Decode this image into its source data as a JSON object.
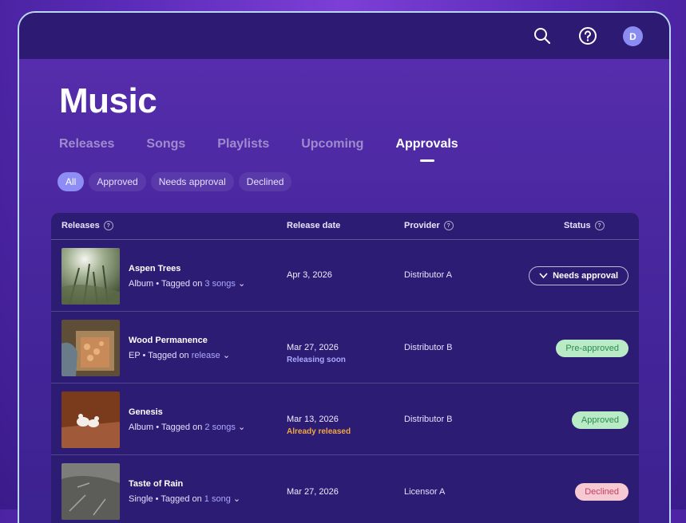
{
  "page": {
    "title": "Music"
  },
  "tabs": [
    "Releases",
    "Songs",
    "Playlists",
    "Upcoming",
    "Approvals"
  ],
  "active_tab": "Approvals",
  "filters": [
    "All",
    "Approved",
    "Needs approval",
    "Declined"
  ],
  "active_filter": "All",
  "user": {
    "avatar_initial": "D"
  },
  "table": {
    "headers": {
      "releases": "Releases",
      "release_date": "Release date",
      "provider": "Provider",
      "status": "Status"
    },
    "rows": [
      {
        "title": "Aspen Trees",
        "type": "Album",
        "tagged_prefix": " • Tagged on ",
        "tagged_link": "3 songs",
        "date": "Apr 3, 2026",
        "note": "",
        "provider": "Distributor A",
        "status": "Needs approval",
        "status_style": "outline"
      },
      {
        "title": "Wood Permanence",
        "type": "EP",
        "tagged_prefix": " • Tagged on ",
        "tagged_link": "release",
        "date": "Mar 27, 2026",
        "note": "Releasing soon",
        "note_color": "#a9a8ff",
        "provider": "Distributor B",
        "status": "Pre-approved",
        "status_style": "green"
      },
      {
        "title": "Genesis",
        "type": "Album",
        "tagged_prefix": " • Tagged on ",
        "tagged_link": "2 songs",
        "date": "Mar 13, 2026",
        "note": "Already released",
        "note_color": "#f0a742",
        "provider": "Distributor B",
        "status": "Approved",
        "status_style": "green"
      },
      {
        "title": "Taste of Rain",
        "type": "Single",
        "tagged_prefix": " • Tagged on ",
        "tagged_link": "1 song",
        "date": "Mar 27, 2026",
        "note": "",
        "provider": "Licensor A",
        "status": "Declined",
        "status_style": "red"
      }
    ]
  },
  "colors": {
    "accent": "#8e8cf5",
    "topbar": "#2c1a73",
    "table_bg": "#2d1c74"
  }
}
